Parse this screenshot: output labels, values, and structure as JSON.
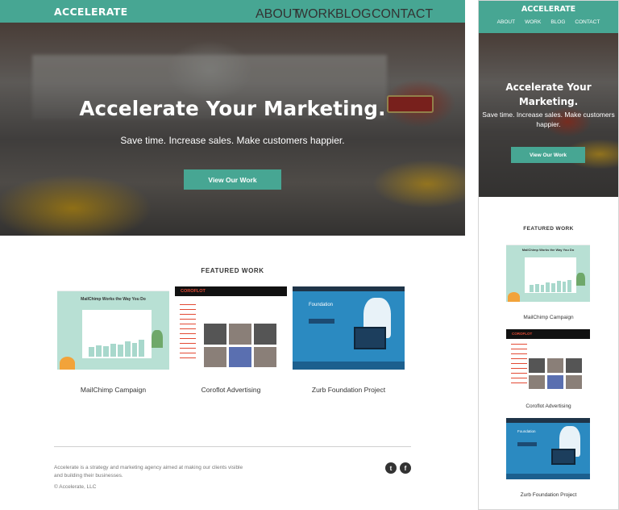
{
  "desktop": {
    "brand": "ACCELERATE",
    "nav": [
      {
        "label": "ABOUT"
      },
      {
        "label": "WORK"
      },
      {
        "label": "BLOG"
      },
      {
        "label": "CONTACT"
      }
    ],
    "hero": {
      "title": "Accelerate Your Marketing.",
      "subtitle": "Save time. Increase sales. Make customers happier.",
      "button": "View Our Work"
    },
    "featured": {
      "heading": "FEATURED WORK",
      "items": [
        {
          "caption": "MailChimp Campaign",
          "thumb_title": "MailChimp Works the Way You Do"
        },
        {
          "caption": "Coroflot Advertising",
          "thumb_logo": "COROFLOT"
        },
        {
          "caption": "Zurb Foundation Project",
          "thumb_title": "Foundation"
        }
      ]
    },
    "footer": {
      "text": "Accelerate is a strategy and marketing agency aimed at making our clients visible and building their businesses.",
      "copyright": "© Accelerate, LLC",
      "social": [
        {
          "icon": "twitter-icon",
          "glyph": "t"
        },
        {
          "icon": "facebook-icon",
          "glyph": "f"
        }
      ]
    }
  },
  "mobile": {
    "brand": "ACCELERATE",
    "nav": [
      {
        "label": "ABOUT"
      },
      {
        "label": "WORK"
      },
      {
        "label": "BLOG"
      },
      {
        "label": "CONTACT"
      }
    ],
    "hero": {
      "title": "Accelerate Your Marketing.",
      "subtitle": "Save time. Increase sales. Make customers happier.",
      "button": "View Our Work"
    },
    "featured": {
      "heading": "FEATURED WORK",
      "items": [
        {
          "caption": "MailChimp Campaign",
          "thumb_title": "MailChimp Works the Way You Do"
        },
        {
          "caption": "Coroflot Advertising",
          "thumb_logo": "COROFLOT"
        },
        {
          "caption": "Zurb Foundation Project",
          "thumb_title": "Foundation"
        }
      ]
    }
  },
  "colors": {
    "accent": "#47a693",
    "text": "#333333",
    "muted": "#777777"
  }
}
